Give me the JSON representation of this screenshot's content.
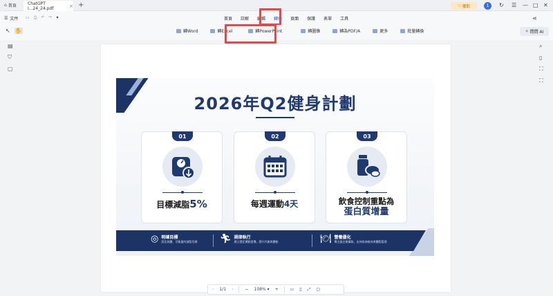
{
  "titlebar": {
    "home_label": "首頁",
    "tab_label": "ChatGPT I...24_24.pdf",
    "tab_close": "×",
    "new_tab": "+",
    "upgrade_label": "獲取",
    "avatar_letter": "1"
  },
  "menubar": {
    "file_label": "文件",
    "menus": [
      "首頁",
      "註解",
      "編輯",
      "轉換",
      "頁面",
      "保護",
      "表單",
      "工具"
    ],
    "active_menu": "轉換"
  },
  "toolbar": {
    "tools": [
      "轉Word",
      "轉Excel",
      "轉PowerPoint",
      "轉圖像",
      "轉為PDF/A",
      "更多",
      "批量轉換"
    ],
    "ask_ai_label": "問問 AI"
  },
  "slide": {
    "title": "2026年Q2健身計劃",
    "cards": [
      {
        "num": "01",
        "text_pre": "目標減脂",
        "text_hl": "5%",
        "text_line2": ""
      },
      {
        "num": "02",
        "text_pre": "每週運動",
        "text_hl": "4天",
        "text_line2": ""
      },
      {
        "num": "03",
        "text_pre": "飲食控制重點為",
        "text_hl": "",
        "text_line2": "蛋白質增量"
      }
    ],
    "banner": [
      {
        "title": "明確目標",
        "sub": "設定具體、可衡量的減脂目標"
      },
      {
        "title": "規律執行",
        "sub": "建立穩定運動習慣，提升代謝與體能"
      },
      {
        "title": "營養優化",
        "sub": "專注蛋白質攝取，支持肌肉維持與體脂管理"
      }
    ]
  },
  "pagebar": {
    "page_indicator": "1/1",
    "zoom": "108%"
  },
  "colors": {
    "accent": "#2b63d9",
    "navy": "#1f3a70",
    "highlight_box": "#e8474a"
  }
}
